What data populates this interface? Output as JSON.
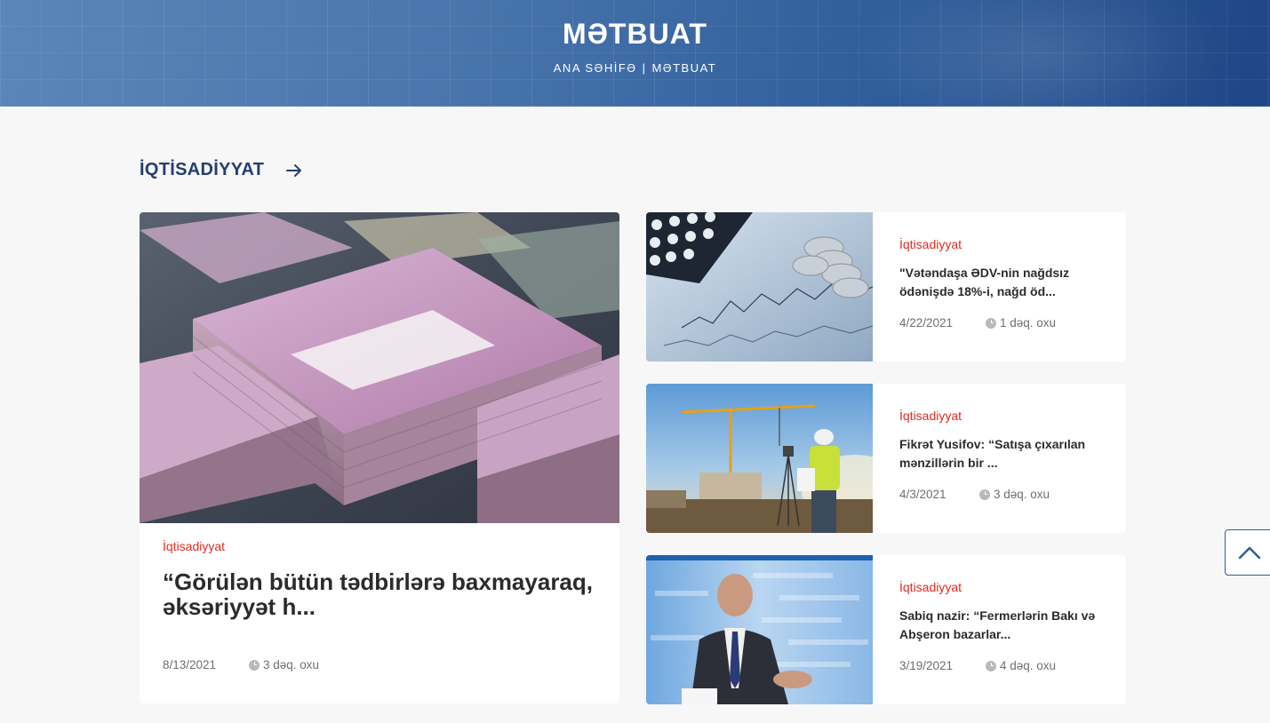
{
  "header": {
    "title": "MƏTBUAT",
    "breadcrumb": {
      "home": "ANA SƏHİFƏ",
      "separator": "|",
      "current": "MƏTBUAT"
    }
  },
  "section": {
    "title": "İQTİSADİYYAT",
    "arrow_icon": "arrow-right-icon"
  },
  "featured": {
    "category": "İqtisadiyyat",
    "title": "“Görülən bütün tədbirlərə baxmayaraq, əksəriyyət h...",
    "date": "8/13/2021",
    "read_time": "3 dəq. oxu",
    "image": "money-stacks-image"
  },
  "articles": [
    {
      "category": "İqtisadiyyat",
      "title": "\"Vətəndaşa ƏDV-nin nağdsız ödənişdə 18%-i, nağd öd...",
      "date": "4/22/2021",
      "read_time": "1 dəq. oxu",
      "image": "calculator-coins-image"
    },
    {
      "category": "İqtisadiyyat",
      "title": "Fikrət Yusifov: “Satışa çıxarılan mənzillərin bir ...",
      "date": "4/3/2021",
      "read_time": "3 dəq. oxu",
      "image": "construction-crane-image"
    },
    {
      "category": "İqtisadiyyat",
      "title": "Sabiq nazir: “Fermerlərin Bakı və Abşeron bazarlar...",
      "date": "3/19/2021",
      "read_time": "4 dəq. oxu",
      "image": "studio-interview-image"
    }
  ],
  "colors": {
    "accent": "#243e6e",
    "category": "#e02b20",
    "hero": "#2f5d9a"
  },
  "back_to_top_icon": "chevron-up-icon"
}
